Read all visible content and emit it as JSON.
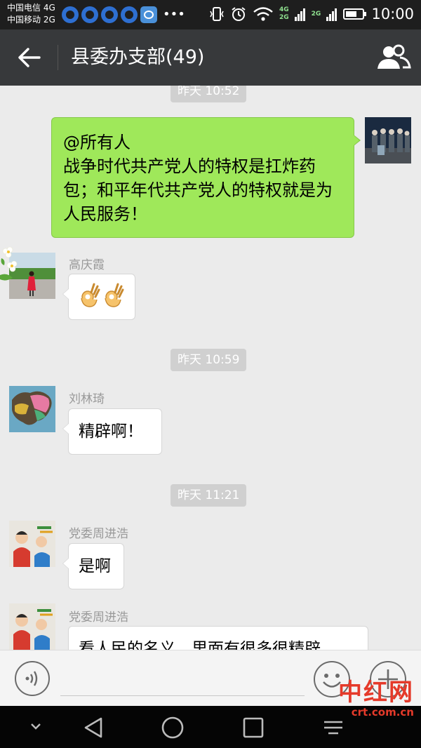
{
  "status_bar": {
    "carrier_1": "中国电信 4G",
    "carrier_2": "中国移动 2G",
    "net_1": "4G",
    "net_2": "2G",
    "net_3": "2G",
    "time": "10:00",
    "battery_level": 0.7
  },
  "header": {
    "title": "县委办支部(49)"
  },
  "messages": {
    "time_1": "昨天 10:52",
    "mine_text": "@所有人\n战争时代共产党人的特权是扛炸药包；和平年代共产党人的特权就是为人民服务！",
    "m1_sender": "高庆霞",
    "time_2": "昨天 10:59",
    "m2_sender": "刘林琦",
    "m2_text": "精辟啊！",
    "time_3": "昨天 11:21",
    "m3_sender": "党委周进浩",
    "m3_text": "是啊",
    "m4_sender": "党委周进浩",
    "m4_text": "看人民的名义，里面有很多很精辟"
  },
  "watermark": {
    "big": "中红网",
    "small": "crt.com.cn"
  },
  "colors": {
    "header_bg": "#37393b",
    "my_bubble": "#9fe85a",
    "chat_bg": "#ebebeb",
    "watermark": "#e53a2a"
  }
}
